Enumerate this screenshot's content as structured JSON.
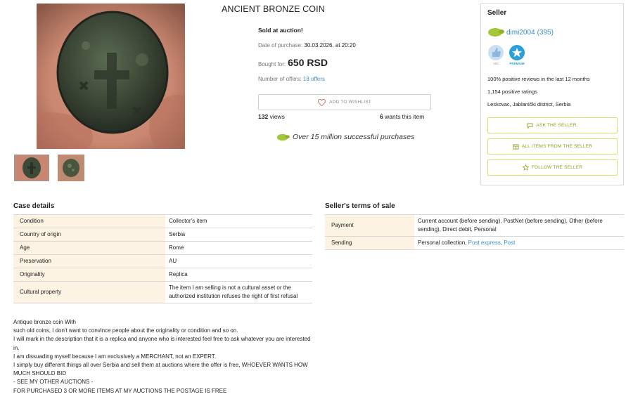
{
  "item": {
    "title": "ANCIENT BRONZE COIN",
    "sold_text": "Sold at auction!",
    "date_label": "Date of purchase:",
    "date_value": "30.03.2026. at 20:20",
    "bought_label": "Bought for:",
    "price": "650 RSD",
    "offers_label": "Number of offers:",
    "offers_value": "18 offers",
    "wishlist_label": "ADD TO WISHLIST",
    "views_count": "132",
    "views_label": "views",
    "wants_count": "6",
    "wants_label": "wants this item",
    "promo_text": "Over 15 million successful purchases"
  },
  "seller": {
    "header": "Seller",
    "name": "dimi2004",
    "rating": "(395)",
    "badge_count_label": "200",
    "badge_premium_label": "PREMIUM",
    "positive_pct": "100% positive reviews in the last 12 months",
    "positive_count": "1,154 positive ratings",
    "location": "Leskovac, Jablanički district, Serbia",
    "ask_button": "ASK THE SELLER.",
    "all_items_button": "ALL ITEMS FROM THE SELLER",
    "follow_button": "FOLLOW THE SELLER"
  },
  "case_details": {
    "title": "Case details",
    "rows": [
      {
        "key": "Condition",
        "value": "Collector's item"
      },
      {
        "key": "Country of origin",
        "value": "Serbia"
      },
      {
        "key": "Age",
        "value": "Rome"
      },
      {
        "key": "Preservation",
        "value": "AU"
      },
      {
        "key": "Originality",
        "value": "Replica"
      },
      {
        "key": "Cultural property",
        "value": "The item I am selling is not a cultural asset or the authorized institution refuses the right of first refusal"
      }
    ]
  },
  "terms": {
    "title": "Seller's terms of sale",
    "payment_key": "Payment",
    "payment_value": "Current account (before sending), PostNet (before sending), Other (before sending), Direct debit, Personal",
    "sending_key": "Sending",
    "sending_value": "Personal collection,",
    "sending_link1": "Post express",
    "sending_sep": ",",
    "sending_link2": "Post"
  },
  "description": [
    "Antique bronze coin With",
    "such old coins, I don't want to convince people about the originality or condition and so on.",
    "I will mark in the description that it is a replica and anyone who is interested feel free to ask whatever you are interested in.",
    "I am dissuading myself because I am exclusively a MERCHANT, not an EXPERT.",
    "I simply buy different things all over Serbia and sell them at auctions where the offer is free, WHOEVER WANTS HOW MUCH SHOULD BID",
    "- SEE MY OTHER AUCTIONS -",
    "FOR PURCHASED 3 OR MORE ITEMS AT MY AUCTIONS THE POSTAGE IS FREE"
  ],
  "colors": {
    "accent_green": "#8aa21d",
    "link_blue": "#3b8fc4",
    "key_bg": "#fdf3e3",
    "logo_green": "#a4c639"
  },
  "icons": [
    "coin-photo",
    "heart-icon",
    "logo-icon",
    "thumbs-up-badge-icon",
    "star-badge-icon",
    "chat-icon",
    "grid-icon",
    "star-icon"
  ]
}
